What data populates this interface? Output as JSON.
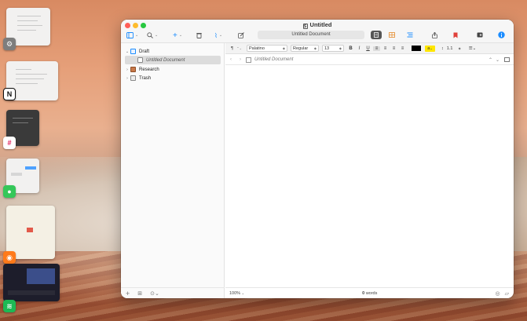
{
  "window": {
    "title": "Untitled"
  },
  "toolbar": {
    "doc_field": "Untitled Document",
    "icons": [
      "sidebar-icon",
      "search-icon",
      "add-icon",
      "trash-icon",
      "paperclip-icon",
      "compose-icon",
      "document-view-icon",
      "grid-view-icon",
      "outline-view-icon",
      "share-icon",
      "bookmark-icon",
      "compile-icon",
      "info-icon"
    ]
  },
  "binder": {
    "items": [
      {
        "label": "Draft"
      },
      {
        "label": "Untitled Document"
      },
      {
        "label": "Research"
      },
      {
        "label": "Trash"
      }
    ]
  },
  "formatbar": {
    "paragraph": "¶",
    "font": "Palatino",
    "style": "Regular",
    "size": "13",
    "bold": "B",
    "italic": "I",
    "underline": "U",
    "highlight": "a",
    "line_spacing": "1.1"
  },
  "editor": {
    "doc_title": "Untitled Document"
  },
  "footer": {
    "zoom": "100%",
    "word_count_value": "0",
    "word_count_unit": "words"
  },
  "colors": {
    "accent": "#1a8cff",
    "bookmark": "#e0403a",
    "text_color": "#000000",
    "highlight_color": "#ffe600"
  }
}
